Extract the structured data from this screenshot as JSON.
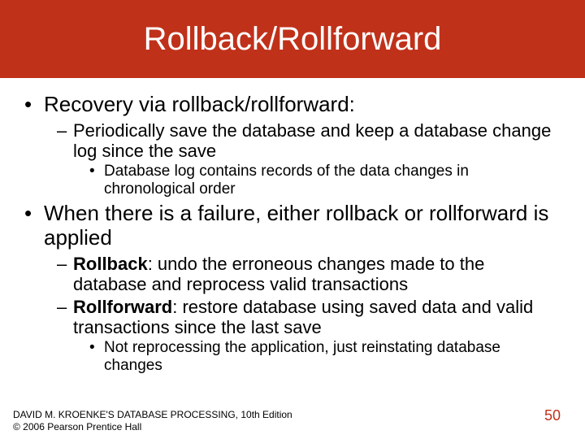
{
  "title": "Rollback/Rollforward",
  "bullets": {
    "b1": "Recovery via rollback/rollforward:",
    "b1_1": "Periodically save the database and keep a database change log since the save",
    "b1_1_1": "Database log contains records of the data changes in chronological order",
    "b2": "When there is a failure, either rollback or rollforward is applied",
    "b2_1_lead": "Rollback",
    "b2_1_rest": ": undo the erroneous changes made to the database and reprocess valid transactions",
    "b2_2_lead": "Rollforward",
    "b2_2_rest": ": restore database using saved data and valid transactions since the last save",
    "b2_2_1": "Not reprocessing the application, just reinstating database changes"
  },
  "footer": {
    "line1": "DAVID M. KROENKE'S DATABASE PROCESSING, 10th Edition",
    "line2": "© 2006 Pearson Prentice Hall"
  },
  "page_number": "50"
}
